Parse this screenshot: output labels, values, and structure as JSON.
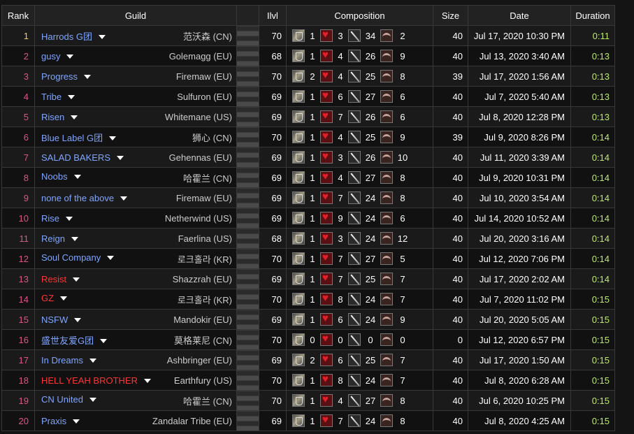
{
  "headers": {
    "rank": "Rank",
    "guild": "Guild",
    "ilvl": "Ilvl",
    "composition": "Composition",
    "size": "Size",
    "date": "Date",
    "duration": "Duration"
  },
  "colors": {
    "guild_link": "#7fa5ff",
    "guild_link_red": "#ff3434",
    "rank_top": "#f0d060",
    "rank": "#e0538a",
    "duration": "#bde86e"
  },
  "icons": [
    "tank-icon",
    "healer-icon",
    "melee-dps-icon",
    "ranged-dps-icon",
    "dropdown-caret-icon"
  ],
  "rows": [
    {
      "rank": "1",
      "guild": "Harrods G团",
      "red": false,
      "server": "范沃森 (CN)",
      "ilvl": "70",
      "tank": "1",
      "heal": "3",
      "dps": "34",
      "rdps": "2",
      "size": "40",
      "date": "Jul 17, 2020 10:30 PM",
      "duration": "0:11"
    },
    {
      "rank": "2",
      "guild": "gusy",
      "red": false,
      "server": "Golemagg (EU)",
      "ilvl": "68",
      "tank": "1",
      "heal": "4",
      "dps": "26",
      "rdps": "9",
      "size": "40",
      "date": "Jul 13, 2020 3:40 AM",
      "duration": "0:13"
    },
    {
      "rank": "3",
      "guild": "Progress",
      "red": false,
      "server": "Firemaw (EU)",
      "ilvl": "70",
      "tank": "2",
      "heal": "4",
      "dps": "25",
      "rdps": "8",
      "size": "39",
      "date": "Jul 17, 2020 1:56 AM",
      "duration": "0:13"
    },
    {
      "rank": "4",
      "guild": "Tribe",
      "red": false,
      "server": "Sulfuron (EU)",
      "ilvl": "69",
      "tank": "1",
      "heal": "6",
      "dps": "27",
      "rdps": "6",
      "size": "40",
      "date": "Jul 7, 2020 5:40 AM",
      "duration": "0:13"
    },
    {
      "rank": "5",
      "guild": "Risen",
      "red": false,
      "server": "Whitemane (US)",
      "ilvl": "69",
      "tank": "1",
      "heal": "7",
      "dps": "26",
      "rdps": "6",
      "size": "40",
      "date": "Jul 8, 2020 12:28 PM",
      "duration": "0:13"
    },
    {
      "rank": "6",
      "guild": "Blue Label G团",
      "red": false,
      "server": "狮心 (CN)",
      "ilvl": "70",
      "tank": "1",
      "heal": "4",
      "dps": "25",
      "rdps": "9",
      "size": "39",
      "date": "Jul 9, 2020 8:26 PM",
      "duration": "0:14"
    },
    {
      "rank": "7",
      "guild": "SALAD BAKERS",
      "red": false,
      "server": "Gehennas (EU)",
      "ilvl": "69",
      "tank": "1",
      "heal": "3",
      "dps": "26",
      "rdps": "10",
      "size": "40",
      "date": "Jul 11, 2020 3:39 AM",
      "duration": "0:14"
    },
    {
      "rank": "8",
      "guild": "Noobs",
      "red": false,
      "server": "哈霍兰 (CN)",
      "ilvl": "69",
      "tank": "1",
      "heal": "4",
      "dps": "27",
      "rdps": "8",
      "size": "40",
      "date": "Jul 9, 2020 10:31 PM",
      "duration": "0:14"
    },
    {
      "rank": "9",
      "guild": "none of the above",
      "red": false,
      "server": "Firemaw (EU)",
      "ilvl": "69",
      "tank": "1",
      "heal": "7",
      "dps": "24",
      "rdps": "8",
      "size": "40",
      "date": "Jul 10, 2020 3:54 AM",
      "duration": "0:14"
    },
    {
      "rank": "10",
      "guild": "Rise",
      "red": false,
      "server": "Netherwind (US)",
      "ilvl": "69",
      "tank": "1",
      "heal": "9",
      "dps": "24",
      "rdps": "6",
      "size": "40",
      "date": "Jul 14, 2020 10:52 AM",
      "duration": "0:14"
    },
    {
      "rank": "11",
      "guild": "Reign",
      "red": false,
      "server": "Faerlina (US)",
      "ilvl": "68",
      "tank": "1",
      "heal": "3",
      "dps": "24",
      "rdps": "12",
      "size": "40",
      "date": "Jul 20, 2020 3:16 AM",
      "duration": "0:14"
    },
    {
      "rank": "12",
      "guild": "Soul Company",
      "red": false,
      "server": "로크홀라 (KR)",
      "ilvl": "70",
      "tank": "1",
      "heal": "7",
      "dps": "27",
      "rdps": "5",
      "size": "40",
      "date": "Jul 12, 2020 7:06 PM",
      "duration": "0:14"
    },
    {
      "rank": "13",
      "guild": "Resist",
      "red": true,
      "server": "Shazzrah (EU)",
      "ilvl": "69",
      "tank": "1",
      "heal": "7",
      "dps": "25",
      "rdps": "7",
      "size": "40",
      "date": "Jul 17, 2020 2:02 AM",
      "duration": "0:14"
    },
    {
      "rank": "14",
      "guild": "GZ",
      "red": true,
      "server": "로크홀라 (KR)",
      "ilvl": "70",
      "tank": "1",
      "heal": "8",
      "dps": "24",
      "rdps": "7",
      "size": "40",
      "date": "Jul 7, 2020 11:02 PM",
      "duration": "0:15"
    },
    {
      "rank": "15",
      "guild": "NSFW",
      "red": false,
      "server": "Mandokir (EU)",
      "ilvl": "69",
      "tank": "1",
      "heal": "6",
      "dps": "24",
      "rdps": "9",
      "size": "40",
      "date": "Jul 20, 2020 5:05 AM",
      "duration": "0:15"
    },
    {
      "rank": "16",
      "guild": "盛世友爱G团",
      "red": false,
      "server": "莫格莱尼 (CN)",
      "ilvl": "70",
      "tank": "0",
      "heal": "0",
      "dps": "0",
      "rdps": "0",
      "size": "0",
      "date": "Jul 12, 2020 6:57 PM",
      "duration": "0:15"
    },
    {
      "rank": "17",
      "guild": "In Dreams",
      "red": false,
      "server": "Ashbringer (EU)",
      "ilvl": "69",
      "tank": "2",
      "heal": "6",
      "dps": "25",
      "rdps": "7",
      "size": "40",
      "date": "Jul 17, 2020 1:50 AM",
      "duration": "0:15"
    },
    {
      "rank": "18",
      "guild": "HELL YEAH BROTHER",
      "red": true,
      "server": "Earthfury (US)",
      "ilvl": "70",
      "tank": "1",
      "heal": "8",
      "dps": "24",
      "rdps": "7",
      "size": "40",
      "date": "Jul 8, 2020 6:28 AM",
      "duration": "0:15"
    },
    {
      "rank": "19",
      "guild": "CN United",
      "red": false,
      "server": "哈霍兰 (CN)",
      "ilvl": "70",
      "tank": "1",
      "heal": "4",
      "dps": "27",
      "rdps": "8",
      "size": "40",
      "date": "Jul 6, 2020 10:25 PM",
      "duration": "0:15"
    },
    {
      "rank": "20",
      "guild": "Praxis",
      "red": false,
      "server": "Zandalar Tribe (EU)",
      "ilvl": "69",
      "tank": "1",
      "heal": "7",
      "dps": "24",
      "rdps": "8",
      "size": "40",
      "date": "Jul 8, 2020 4:25 AM",
      "duration": "0:15"
    }
  ]
}
